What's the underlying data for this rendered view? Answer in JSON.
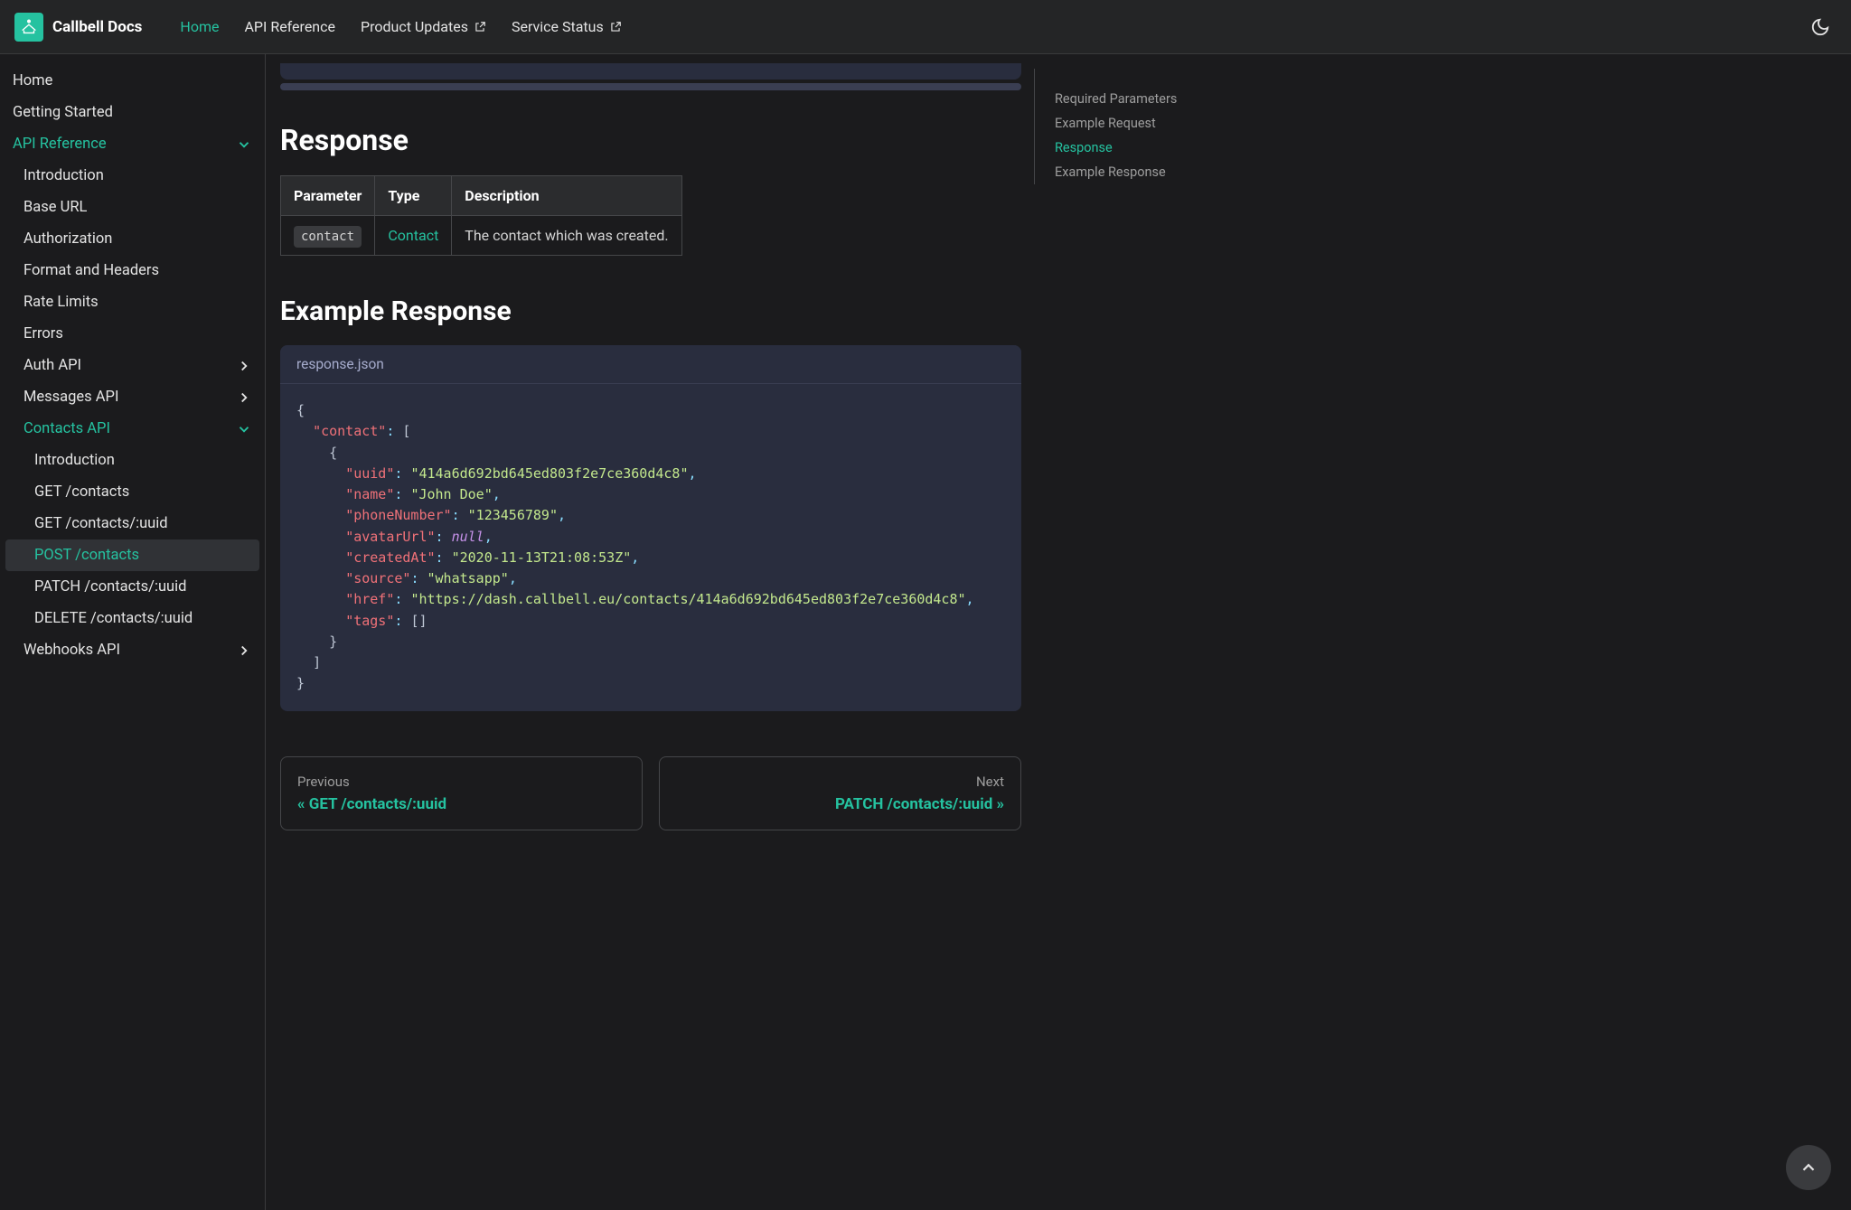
{
  "brand": "Callbell Docs",
  "nav": {
    "home": "Home",
    "api": "API Reference",
    "updates": "Product Updates",
    "status": "Service Status"
  },
  "sidebar": {
    "home": "Home",
    "getting_started": "Getting Started",
    "api_ref": "API Reference",
    "introduction": "Introduction",
    "base_url": "Base URL",
    "authorization": "Authorization",
    "format": "Format and Headers",
    "rate_limits": "Rate Limits",
    "errors": "Errors",
    "auth_api": "Auth API",
    "messages_api": "Messages API",
    "contacts_api": "Contacts API",
    "contacts_intro": "Introduction",
    "get_contacts": "GET /contacts",
    "get_contact": "GET /contacts/:uuid",
    "post_contacts": "POST /contacts",
    "patch_contact": "PATCH /contacts/:uuid",
    "delete_contact": "DELETE /contacts/:uuid",
    "webhooks": "Webhooks API"
  },
  "headings": {
    "response": "Response",
    "example_response": "Example Response"
  },
  "table": {
    "h_param": "Parameter",
    "h_type": "Type",
    "h_desc": "Description",
    "param": "contact",
    "type": "Contact",
    "desc": "The contact which was created."
  },
  "code": {
    "filename": "response.json",
    "uuid": "\"414a6d692bd645ed803f2e7ce360d4c8\"",
    "name": "\"John Doe\"",
    "phone": "\"123456789\"",
    "avatar": "null",
    "created": "\"2020-11-13T21:08:53Z\"",
    "source": "\"whatsapp\"",
    "href": "\"https://dash.callbell.eu/contacts/414a6d692bd645ed803f2e7ce360d4c8\"",
    "k_contact": "\"contact\"",
    "k_uuid": "\"uuid\"",
    "k_name": "\"name\"",
    "k_phone": "\"phoneNumber\"",
    "k_avatar": "\"avatarUrl\"",
    "k_created": "\"createdAt\"",
    "k_source": "\"source\"",
    "k_href": "\"href\"",
    "k_tags": "\"tags\""
  },
  "pager": {
    "prev_sub": "Previous",
    "prev_title": "« GET /contacts/:uuid",
    "next_sub": "Next",
    "next_title": "PATCH /contacts/:uuid »"
  },
  "toc": {
    "required": "Required Parameters",
    "example_req": "Example Request",
    "response": "Response",
    "example_resp": "Example Response"
  }
}
